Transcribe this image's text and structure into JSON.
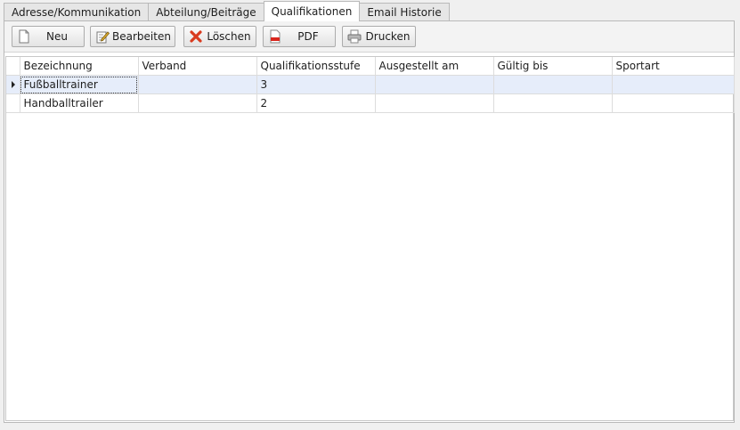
{
  "tabs": [
    {
      "label": "Adresse/Kommunikation",
      "active": false
    },
    {
      "label": "Abteilung/Beiträge",
      "active": false
    },
    {
      "label": "Qualifikationen",
      "active": true
    },
    {
      "label": "Email Historie",
      "active": false
    }
  ],
  "toolbar": {
    "new_label": "Neu",
    "edit_label": "Bearbeiten",
    "delete_label": "Löschen",
    "pdf_label": "PDF",
    "print_label": "Drucken"
  },
  "grid": {
    "columns": [
      "Bezeichnung",
      "Verband",
      "Qualifikationsstufe",
      "Ausgestellt am",
      "Gültig bis",
      "Sportart"
    ],
    "rows": [
      {
        "bezeichnung": "Fußballtrainer",
        "verband": "",
        "stufe": "3",
        "ausgestellt": "",
        "gueltig": "",
        "sportart": ""
      },
      {
        "bezeichnung": "Handballtrailer",
        "verband": "",
        "stufe": "2",
        "ausgestellt": "",
        "gueltig": "",
        "sportart": ""
      }
    ]
  },
  "icons": {
    "new": "document-icon",
    "edit": "edit-icon",
    "delete": "delete-x-icon",
    "pdf": "pdf-icon",
    "print": "printer-icon"
  },
  "colors": {
    "selection": "#e6edfa",
    "delete_red": "#d93b1f"
  }
}
